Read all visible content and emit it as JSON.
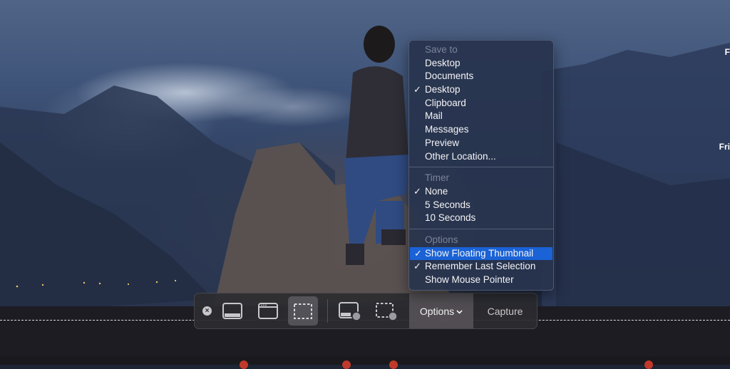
{
  "desktop": {
    "right_labels": [
      "F",
      "Fri"
    ]
  },
  "toolbar": {
    "close_label": "×",
    "buttons": [
      {
        "name": "capture-entire-screen",
        "active": false
      },
      {
        "name": "capture-selected-window",
        "active": false
      },
      {
        "name": "capture-selected-portion",
        "active": true
      },
      {
        "name": "record-entire-screen",
        "active": false
      },
      {
        "name": "record-selected-portion",
        "active": false
      }
    ],
    "options_label": "Options",
    "capture_label": "Capture"
  },
  "menu": {
    "save_to": {
      "header": "Save to",
      "items": [
        {
          "label": "Desktop",
          "checked": false
        },
        {
          "label": "Documents",
          "checked": false
        },
        {
          "label": "Desktop",
          "checked": true
        },
        {
          "label": "Clipboard",
          "checked": false
        },
        {
          "label": "Mail",
          "checked": false
        },
        {
          "label": "Messages",
          "checked": false
        },
        {
          "label": "Preview",
          "checked": false
        },
        {
          "label": "Other Location...",
          "checked": false
        }
      ]
    },
    "timer": {
      "header": "Timer",
      "items": [
        {
          "label": "None",
          "checked": true
        },
        {
          "label": "5 Seconds",
          "checked": false
        },
        {
          "label": "10 Seconds",
          "checked": false
        }
      ]
    },
    "options": {
      "header": "Options",
      "items": [
        {
          "label": "Show Floating Thumbnail",
          "checked": true,
          "highlighted": true
        },
        {
          "label": "Remember Last Selection",
          "checked": true,
          "highlighted": false
        },
        {
          "label": "Show Mouse Pointer",
          "checked": false,
          "highlighted": false
        }
      ]
    },
    "check_glyph": "✓"
  },
  "colors": {
    "highlight": "#1a62d6",
    "menu_bg": "#28344e",
    "toolbar_bg": "#2c2c30"
  }
}
